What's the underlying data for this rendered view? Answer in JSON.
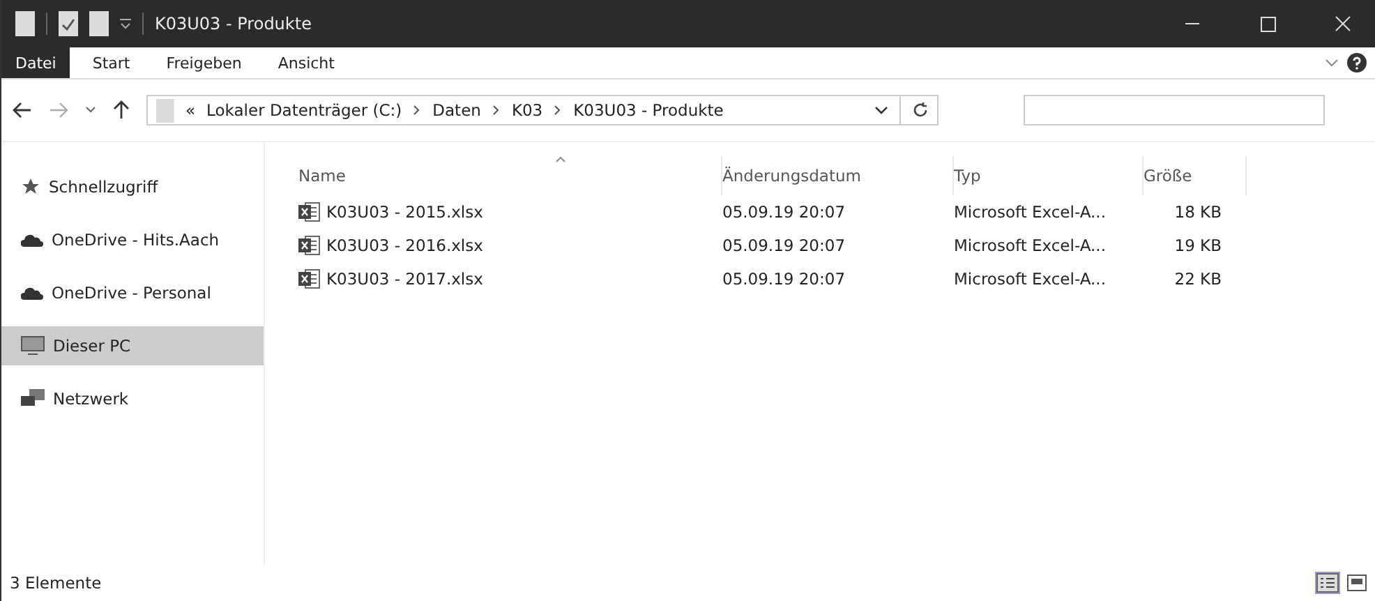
{
  "window": {
    "title": "K03U03 - Produkte"
  },
  "ribbon_tabs": [
    {
      "label": "Datei",
      "selected": true
    },
    {
      "label": "Start",
      "selected": false
    },
    {
      "label": "Freigeben",
      "selected": false
    },
    {
      "label": "Ansicht",
      "selected": false
    }
  ],
  "address": {
    "overflow": "«",
    "segments": [
      "Lokaler Datenträger (C:)",
      "Daten",
      "K03",
      "K03U03 - Produkte"
    ]
  },
  "sidebar": {
    "items": [
      {
        "label": "Schnellzugriff",
        "kind": "star",
        "selected": false
      },
      {
        "label": "OneDrive - Hits.Aach",
        "kind": "cloud",
        "selected": false
      },
      {
        "label": "OneDrive - Personal",
        "kind": "cloud",
        "selected": false
      },
      {
        "label": "Dieser PC",
        "kind": "pc",
        "selected": true
      },
      {
        "label": "Netzwerk",
        "kind": "network",
        "selected": false
      }
    ]
  },
  "table": {
    "columns": [
      "Name",
      "Änderungsdatum",
      "Typ",
      "Größe"
    ],
    "rows": [
      {
        "name": "K03U03 - 2015.xlsx",
        "date": "05.09.19 20:07",
        "type": "Microsoft Excel-A...",
        "size": "18 KB"
      },
      {
        "name": "K03U03 - 2016.xlsx",
        "date": "05.09.19 20:07",
        "type": "Microsoft Excel-A...",
        "size": "19 KB"
      },
      {
        "name": "K03U03 - 2017.xlsx",
        "date": "05.09.19 20:07",
        "type": "Microsoft Excel-A...",
        "size": "22 KB"
      }
    ]
  },
  "status_bar": {
    "count": "3 Elemente"
  }
}
